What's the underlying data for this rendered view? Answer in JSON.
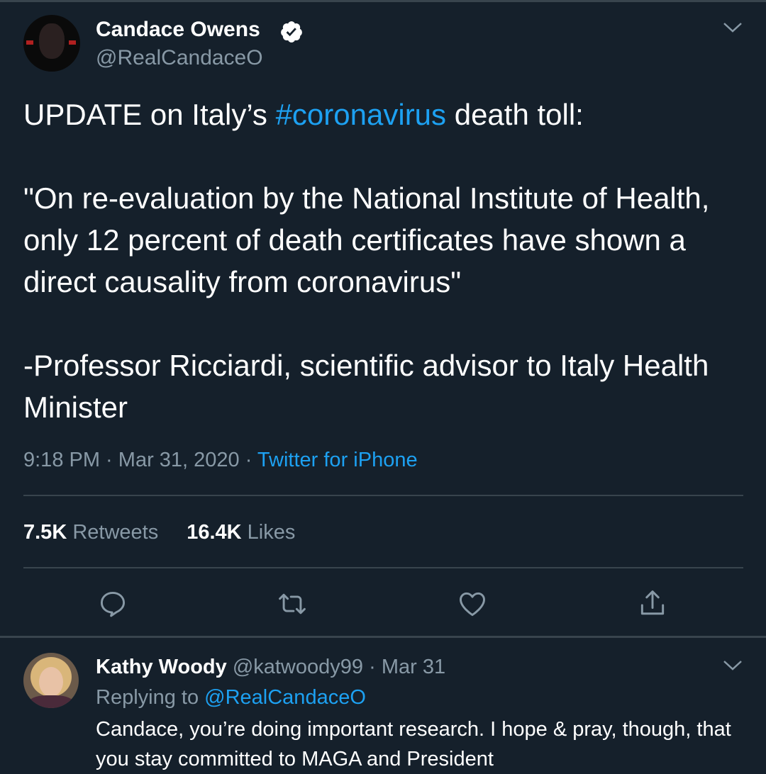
{
  "tweet": {
    "author_name": "Candace Owens",
    "author_handle": "@RealCandaceO",
    "verified": true,
    "text_before_hashtag": "UPDATE on Italy’s ",
    "hashtag": "#coronavirus",
    "text_after_hashtag": " death toll:\n\n\"On re-evaluation by the National Institute of Health, only 12 percent of death certificates have shown a direct causality from coronavirus\"\n\n-Professor Ricciardi, scientific advisor to Italy Health Minister",
    "time": "9:18 PM",
    "date": "Mar 31, 2020",
    "meta_separator": " · ",
    "source": "Twitter for iPhone",
    "retweets_count": "7.5K",
    "retweets_label": "Retweets",
    "likes_count": "16.4K",
    "likes_label": "Likes"
  },
  "actions": [
    {
      "icon": "reply-icon"
    },
    {
      "icon": "retweet-icon"
    },
    {
      "icon": "like-icon"
    },
    {
      "icon": "share-icon"
    }
  ],
  "reply": {
    "author_name": "Kathy Woody",
    "author_handle": "@katwoody99",
    "separator": "·",
    "date": "Mar 31",
    "replying_to_label": "Replying to",
    "replying_to_handle": "@RealCandaceO",
    "text": "Candace, you’re doing important research. I hope & pray, though, that you stay committed to MAGA and President"
  },
  "colors": {
    "background": "#15202b",
    "accent": "#1da1f2",
    "secondary_text": "#8899a6",
    "divider": "#38444d"
  }
}
